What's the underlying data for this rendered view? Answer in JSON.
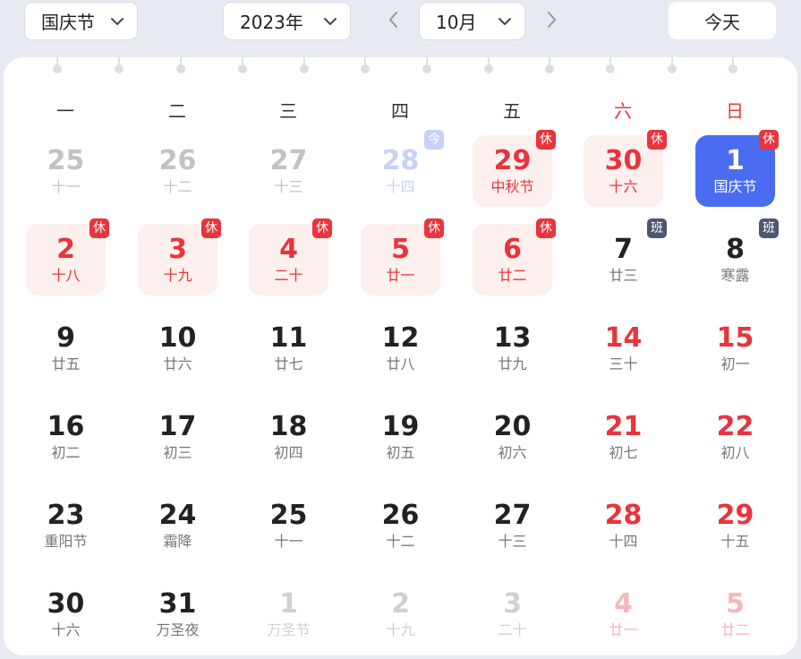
{
  "toolbar": {
    "holiday": "国庆节",
    "year": "2023年",
    "month": "10月",
    "today_label": "今天"
  },
  "weekdays": [
    "一",
    "二",
    "三",
    "四",
    "五",
    "六",
    "日"
  ],
  "colors": {
    "accent": "#4a6cf0",
    "holiday_red": "#e8343d",
    "rest_bg": "#fdf0ee",
    "work_badge": "#4d5670"
  },
  "icons": {
    "dropdown": "chevron-down-icon",
    "prev": "chevron-left-icon",
    "next": "chevron-right-icon"
  },
  "weeks": [
    [
      {
        "day": "25",
        "sub": "十一",
        "state": "other"
      },
      {
        "day": "26",
        "sub": "十二",
        "state": "other"
      },
      {
        "day": "27",
        "sub": "十三",
        "state": "other"
      },
      {
        "day": "28",
        "sub": "十四",
        "state": "today",
        "badge": "今"
      },
      {
        "day": "29",
        "sub": "中秋节",
        "state": "rest",
        "badge": "休"
      },
      {
        "day": "30",
        "sub": "十六",
        "state": "rest",
        "badge": "休"
      },
      {
        "day": "1",
        "sub": "国庆节",
        "state": "selected",
        "badge": "休"
      }
    ],
    [
      {
        "day": "2",
        "sub": "十八",
        "state": "rest",
        "badge": "休"
      },
      {
        "day": "3",
        "sub": "十九",
        "state": "rest",
        "badge": "休"
      },
      {
        "day": "4",
        "sub": "二十",
        "state": "rest",
        "badge": "休"
      },
      {
        "day": "5",
        "sub": "廿一",
        "state": "rest",
        "badge": "休"
      },
      {
        "day": "6",
        "sub": "廿二",
        "state": "rest",
        "badge": "休"
      },
      {
        "day": "7",
        "sub": "廿三",
        "state": "work",
        "badge": "班"
      },
      {
        "day": "8",
        "sub": "寒露",
        "state": "work",
        "badge": "班"
      }
    ],
    [
      {
        "day": "9",
        "sub": "廿五",
        "state": "normal"
      },
      {
        "day": "10",
        "sub": "廿六",
        "state": "normal"
      },
      {
        "day": "11",
        "sub": "廿七",
        "state": "normal"
      },
      {
        "day": "12",
        "sub": "廿八",
        "state": "normal"
      },
      {
        "day": "13",
        "sub": "廿九",
        "state": "normal"
      },
      {
        "day": "14",
        "sub": "三十",
        "state": "weekend"
      },
      {
        "day": "15",
        "sub": "初一",
        "state": "weekend"
      }
    ],
    [
      {
        "day": "16",
        "sub": "初二",
        "state": "normal"
      },
      {
        "day": "17",
        "sub": "初三",
        "state": "normal"
      },
      {
        "day": "18",
        "sub": "初四",
        "state": "normal"
      },
      {
        "day": "19",
        "sub": "初五",
        "state": "normal"
      },
      {
        "day": "20",
        "sub": "初六",
        "state": "normal"
      },
      {
        "day": "21",
        "sub": "初七",
        "state": "weekend"
      },
      {
        "day": "22",
        "sub": "初八",
        "state": "weekend"
      }
    ],
    [
      {
        "day": "23",
        "sub": "重阳节",
        "state": "normal"
      },
      {
        "day": "24",
        "sub": "霜降",
        "state": "normal"
      },
      {
        "day": "25",
        "sub": "十一",
        "state": "normal"
      },
      {
        "day": "26",
        "sub": "十二",
        "state": "normal"
      },
      {
        "day": "27",
        "sub": "十三",
        "state": "normal"
      },
      {
        "day": "28",
        "sub": "十四",
        "state": "weekend"
      },
      {
        "day": "29",
        "sub": "十五",
        "state": "weekend"
      }
    ],
    [
      {
        "day": "30",
        "sub": "十六",
        "state": "normal"
      },
      {
        "day": "31",
        "sub": "万圣夜",
        "state": "normal"
      },
      {
        "day": "1",
        "sub": "万圣节",
        "state": "other-past"
      },
      {
        "day": "2",
        "sub": "十九",
        "state": "other-past"
      },
      {
        "day": "3",
        "sub": "二十",
        "state": "other-past"
      },
      {
        "day": "4",
        "sub": "廿一",
        "state": "other-weekend"
      },
      {
        "day": "5",
        "sub": "廿二",
        "state": "other-weekend"
      }
    ]
  ]
}
